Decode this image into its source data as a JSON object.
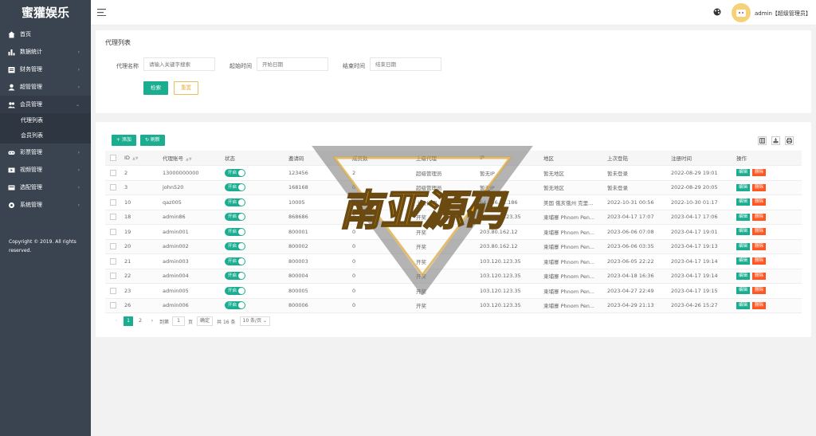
{
  "brand": "蜜獾娱乐",
  "nav": [
    {
      "name": "home",
      "label": "首页",
      "caret": ""
    },
    {
      "name": "stats",
      "label": "数据统计",
      "caret": "›"
    },
    {
      "name": "finance",
      "label": "财务管理",
      "caret": "›"
    },
    {
      "name": "super",
      "label": "超管管理",
      "caret": "›"
    },
    {
      "name": "member",
      "label": "会员管理",
      "caret": "⌄"
    }
  ],
  "sub_nav": [
    "代理列表",
    "会员列表"
  ],
  "nav2": [
    {
      "name": "lottery",
      "label": "彩票管理",
      "caret": "›"
    },
    {
      "name": "video",
      "label": "视频管理",
      "caret": "›"
    },
    {
      "name": "ads",
      "label": "选配管理",
      "caret": "›"
    },
    {
      "name": "system",
      "label": "系统管理",
      "caret": "›"
    }
  ],
  "copyright": "Copyright © 2019. All rights reserved.",
  "header": {
    "user": "admin【超级管理员】"
  },
  "filter": {
    "title": "代理列表",
    "name_label": "代理名称",
    "name_placeholder": "请输入关键字搜索",
    "start_label": "起始时间",
    "start_placeholder": "开始日期",
    "end_label": "结束时间",
    "end_placeholder": "结束日期",
    "search_btn": "检索",
    "reset_btn": "重置"
  },
  "toolbar": {
    "add": "+ 添加",
    "refresh": "↻ 刷新"
  },
  "table": {
    "headers": [
      "",
      "ID",
      "代理账号",
      "状态",
      "邀请码",
      "成员数",
      "上级代理",
      "IP",
      "地区",
      "上次登陆",
      "注册时间",
      "操作"
    ],
    "status_label": "开启",
    "edit_label": "编辑",
    "delete_label": "删除",
    "rows": [
      {
        "id": "2",
        "account": "13000000000",
        "code": "123456",
        "members": "2",
        "parent": "超级管理员",
        "ip": "暂无IP",
        "region": "暂无地区",
        "last_login": "暂未登录",
        "reg_time": "2022-08-29 19:01"
      },
      {
        "id": "3",
        "account": "john520",
        "code": "168168",
        "members": "0",
        "parent": "超级管理员",
        "ip": "暂无IP",
        "region": "暂无地区",
        "last_login": "暂未登录",
        "reg_time": "2022-08-29 20:05"
      },
      {
        "id": "10",
        "account": "qaz005",
        "code": "10005",
        "members": "0",
        "parent": "上级代理",
        "ip": "64.156.61.186",
        "region": "美国 俄亥俄州 克里...",
        "last_login": "2022-10-31 00:56",
        "reg_time": "2022-10-30 01:17"
      },
      {
        "id": "18",
        "account": "admin86",
        "code": "868686",
        "members": "0",
        "parent": "开奖",
        "ip": "103.120.123.35",
        "region": "柬埔寨 Phnom Pen...",
        "last_login": "2023-04-17 17:07",
        "reg_time": "2023-04-17 17:06"
      },
      {
        "id": "19",
        "account": "admin001",
        "code": "800001",
        "members": "0",
        "parent": "开奖",
        "ip": "203.80.162.12",
        "region": "柬埔寨 Phnom Pen...",
        "last_login": "2023-06-06 07:08",
        "reg_time": "2023-04-17 19:01"
      },
      {
        "id": "20",
        "account": "admin002",
        "code": "800002",
        "members": "0",
        "parent": "开奖",
        "ip": "203.80.162.12",
        "region": "柬埔寨 Phnom Pen...",
        "last_login": "2023-06-06 03:35",
        "reg_time": "2023-04-17 19:13"
      },
      {
        "id": "21",
        "account": "admin003",
        "code": "800003",
        "members": "0",
        "parent": "开奖",
        "ip": "103.120.123.35",
        "region": "柬埔寨 Phnom Pen...",
        "last_login": "2023-06-05 22:22",
        "reg_time": "2023-04-17 19:14"
      },
      {
        "id": "22",
        "account": "admin004",
        "code": "800004",
        "members": "0",
        "parent": "开奖",
        "ip": "103.120.123.35",
        "region": "柬埔寨 Phnom Pen...",
        "last_login": "2023-04-18 16:36",
        "reg_time": "2023-04-17 19:14"
      },
      {
        "id": "23",
        "account": "admin005",
        "code": "800005",
        "members": "0",
        "parent": "开奖",
        "ip": "103.120.123.35",
        "region": "柬埔寨 Phnom Pen...",
        "last_login": "2023-04-27 22:49",
        "reg_time": "2023-04-17 19:15"
      },
      {
        "id": "26",
        "account": "admin006",
        "code": "800006",
        "members": "0",
        "parent": "开奖",
        "ip": "103.120.123.35",
        "region": "柬埔寨 Phnom Pen...",
        "last_login": "2023-04-29 21:13",
        "reg_time": "2023-04-26 15:27"
      }
    ]
  },
  "pager": {
    "prev": "‹",
    "page1": "1",
    "page2": "2",
    "next": "›",
    "goto_label": "到第",
    "goto_value": "1",
    "page_unit": "页",
    "confirm": "确定",
    "total": "共 16 条",
    "per_page": "10 条/页 ⌄"
  },
  "watermark": "南亚源码"
}
